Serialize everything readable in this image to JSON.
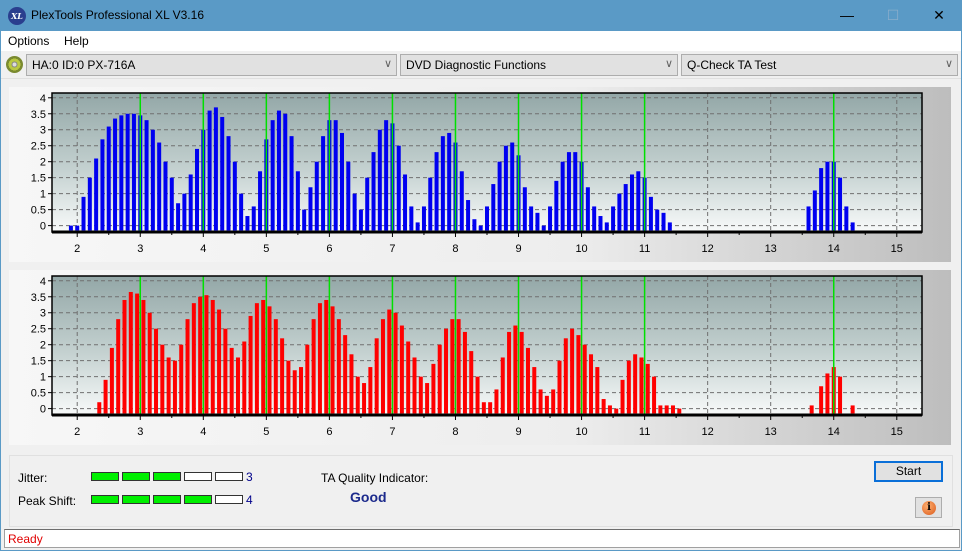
{
  "window": {
    "title": "PlexTools Professional XL V3.16",
    "logo_text": "XL",
    "minimize": "—",
    "maximize": "☐",
    "close": "✕"
  },
  "menu": {
    "items": [
      "Options",
      "Help"
    ]
  },
  "toolbar": {
    "drive": "HA:0 ID:0  PX-716A",
    "function": "DVD Diagnostic Functions",
    "test": "Q-Check TA Test",
    "chevron": "∨"
  },
  "bottom": {
    "jitter_label": "Jitter:",
    "jitter_value": "3",
    "jitter_level": 3,
    "peak_label": "Peak Shift:",
    "peak_value": "4",
    "peak_level": 4,
    "segments_total": 5,
    "ta_label": "TA Quality Indicator:",
    "ta_value": "Good",
    "start_label": "Start",
    "info_icon": "i"
  },
  "status": {
    "text": "Ready"
  },
  "colors": {
    "blue_bars": "#0000f0",
    "red_bars": "#ff0000",
    "marker": "#00e000",
    "status_text": "#e00000",
    "quality_text": "#1c2a8c"
  },
  "chart_data": [
    {
      "type": "bar",
      "name": "land-ta-distribution",
      "color": "#0000f0",
      "xlim": [
        1.6,
        15.4
      ],
      "ylim": [
        -0.2,
        4.15
      ],
      "xticks": [
        2,
        3,
        4,
        5,
        6,
        7,
        8,
        9,
        10,
        11,
        12,
        13,
        14,
        15
      ],
      "yticks": [
        0,
        0.5,
        1,
        1.5,
        2,
        2.5,
        3,
        3.5,
        4
      ],
      "ytick_labels": [
        "0",
        "0.5",
        "1",
        "1.5",
        "2",
        "2.5",
        "3",
        "3.5",
        "4"
      ],
      "markers": [
        3,
        4,
        5,
        6,
        7,
        8,
        9,
        10,
        11,
        14
      ],
      "grid": true,
      "x": [
        1.9,
        2.0,
        2.1,
        2.2,
        2.3,
        2.4,
        2.5,
        2.6,
        2.7,
        2.8,
        2.9,
        3.0,
        3.1,
        3.2,
        3.3,
        3.4,
        3.5,
        3.6,
        3.7,
        3.8,
        3.9,
        4.0,
        4.1,
        4.2,
        4.3,
        4.4,
        4.5,
        4.6,
        4.7,
        4.8,
        4.9,
        5.0,
        5.1,
        5.2,
        5.3,
        5.4,
        5.5,
        5.6,
        5.7,
        5.8,
        5.9,
        6.0,
        6.1,
        6.2,
        6.3,
        6.4,
        6.5,
        6.6,
        6.7,
        6.8,
        6.9,
        7.0,
        7.1,
        7.2,
        7.3,
        7.4,
        7.5,
        7.6,
        7.7,
        7.8,
        7.9,
        8.0,
        8.1,
        8.2,
        8.3,
        8.4,
        8.5,
        8.6,
        8.7,
        8.8,
        8.9,
        9.0,
        9.1,
        9.2,
        9.3,
        9.4,
        9.5,
        9.6,
        9.7,
        9.8,
        9.9,
        10.0,
        10.1,
        10.2,
        10.3,
        10.4,
        10.5,
        10.6,
        10.7,
        10.8,
        10.9,
        11.0,
        11.1,
        11.2,
        11.3,
        11.4,
        13.6,
        13.7,
        13.8,
        13.9,
        14.0,
        14.1,
        14.2,
        14.3
      ],
      "values": [
        0,
        0,
        0.9,
        1.5,
        2.1,
        2.7,
        3.1,
        3.35,
        3.45,
        3.5,
        3.5,
        3.45,
        3.3,
        3.0,
        2.6,
        2.0,
        1.5,
        0.7,
        1.0,
        1.6,
        2.4,
        3.0,
        3.6,
        3.7,
        3.4,
        2.8,
        2.0,
        1.0,
        0.3,
        0.6,
        1.7,
        2.7,
        3.3,
        3.6,
        3.5,
        2.8,
        1.7,
        0.5,
        1.2,
        2.0,
        2.8,
        3.3,
        3.3,
        2.9,
        2.0,
        1.0,
        0.5,
        1.5,
        2.3,
        3.0,
        3.3,
        3.2,
        2.5,
        1.6,
        0.6,
        0.1,
        0.6,
        1.5,
        2.3,
        2.8,
        2.9,
        2.6,
        1.7,
        0.8,
        0.2,
        0.0,
        0.6,
        1.3,
        2.0,
        2.5,
        2.6,
        2.2,
        1.2,
        0.6,
        0.4,
        0.0,
        0.6,
        1.4,
        2.0,
        2.3,
        2.3,
        2.0,
        1.2,
        0.6,
        0.3,
        0.1,
        0.6,
        1.0,
        1.3,
        1.6,
        1.7,
        1.5,
        0.9,
        0.5,
        0.4,
        0.1,
        0.6,
        1.1,
        1.8,
        2.0,
        2.0,
        1.5,
        0.6,
        0.1
      ]
    },
    {
      "type": "bar",
      "name": "pit-ta-distribution",
      "color": "#ff0000",
      "xlim": [
        1.6,
        15.4
      ],
      "ylim": [
        -0.2,
        4.15
      ],
      "xticks": [
        2,
        3,
        4,
        5,
        6,
        7,
        8,
        9,
        10,
        11,
        12,
        13,
        14,
        15
      ],
      "yticks": [
        0,
        0.5,
        1,
        1.5,
        2,
        2.5,
        3,
        3.5,
        4
      ],
      "ytick_labels": [
        "0",
        "0.5",
        "1",
        "1.5",
        "2",
        "2.5",
        "3",
        "3.5",
        "4"
      ],
      "markers": [
        3,
        4,
        5,
        6,
        7,
        8,
        9,
        10,
        11,
        14
      ],
      "grid": true,
      "x": [
        2.35,
        2.45,
        2.55,
        2.65,
        2.75,
        2.85,
        2.95,
        3.05,
        3.15,
        3.25,
        3.35,
        3.45,
        3.55,
        3.65,
        3.75,
        3.85,
        3.95,
        4.05,
        4.15,
        4.25,
        4.35,
        4.45,
        4.55,
        4.65,
        4.75,
        4.85,
        4.95,
        5.05,
        5.15,
        5.25,
        5.35,
        5.45,
        5.55,
        5.65,
        5.75,
        5.85,
        5.95,
        6.05,
        6.15,
        6.25,
        6.35,
        6.45,
        6.55,
        6.65,
        6.75,
        6.85,
        6.95,
        7.05,
        7.15,
        7.25,
        7.35,
        7.45,
        7.55,
        7.65,
        7.75,
        7.85,
        7.95,
        8.05,
        8.15,
        8.25,
        8.35,
        8.45,
        8.55,
        8.65,
        8.75,
        8.85,
        8.95,
        9.05,
        9.15,
        9.25,
        9.35,
        9.45,
        9.55,
        9.65,
        9.75,
        9.85,
        9.95,
        10.05,
        10.15,
        10.25,
        10.35,
        10.45,
        10.55,
        10.65,
        10.75,
        10.85,
        10.95,
        11.05,
        11.15,
        11.25,
        11.35,
        11.45,
        11.55,
        13.65,
        13.8,
        13.9,
        14.0,
        14.1,
        14.3
      ],
      "values": [
        0.2,
        0.9,
        1.9,
        2.8,
        3.4,
        3.65,
        3.6,
        3.4,
        3.0,
        2.5,
        2.0,
        1.6,
        1.5,
        2.0,
        2.8,
        3.3,
        3.5,
        3.55,
        3.4,
        3.1,
        2.5,
        1.9,
        1.6,
        2.1,
        2.9,
        3.3,
        3.4,
        3.2,
        2.8,
        2.2,
        1.5,
        1.2,
        1.3,
        2.0,
        2.8,
        3.3,
        3.4,
        3.2,
        2.8,
        2.3,
        1.7,
        1.0,
        0.8,
        1.3,
        2.2,
        2.8,
        3.1,
        3.0,
        2.6,
        2.1,
        1.6,
        1.0,
        0.8,
        1.4,
        2.0,
        2.5,
        2.8,
        2.8,
        2.4,
        1.8,
        1.0,
        0.2,
        0.2,
        0.6,
        1.6,
        2.4,
        2.6,
        2.4,
        1.9,
        1.3,
        0.6,
        0.4,
        0.6,
        1.5,
        2.2,
        2.5,
        2.3,
        2.0,
        1.7,
        1.3,
        0.3,
        0.1,
        0.0,
        0.9,
        1.5,
        1.7,
        1.6,
        1.4,
        1.0,
        0.1,
        0.1,
        0.1,
        0.0,
        0.1,
        0.7,
        1.1,
        1.3,
        1.0,
        0.1
      ]
    }
  ]
}
